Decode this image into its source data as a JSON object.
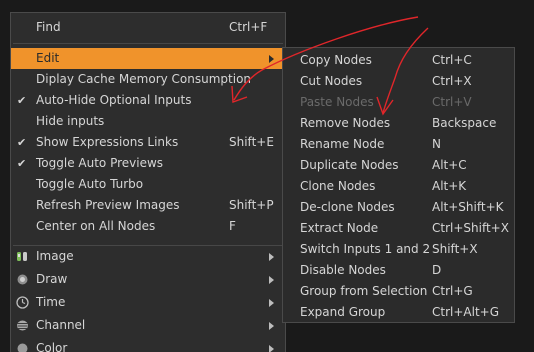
{
  "main_menu": {
    "find": {
      "label": "Find",
      "shortcut": "Ctrl+F"
    },
    "edit": {
      "label": "Edit"
    },
    "items": [
      {
        "label": "Diplay Cache Memory Consumption",
        "shortcut": "",
        "checked": false
      },
      {
        "label": "Auto-Hide Optional Inputs",
        "shortcut": "",
        "checked": true
      },
      {
        "label": "Hide inputs",
        "shortcut": "",
        "checked": false
      },
      {
        "label": "Show Expressions Links",
        "shortcut": "Shift+E",
        "checked": true
      },
      {
        "label": "Toggle Auto Previews",
        "shortcut": "",
        "checked": true
      },
      {
        "label": "Toggle Auto Turbo",
        "shortcut": "",
        "checked": false
      },
      {
        "label": "Refresh Preview Images",
        "shortcut": "Shift+P",
        "checked": false
      },
      {
        "label": "Center on All Nodes",
        "shortcut": "F",
        "checked": false
      }
    ],
    "check_glyph": "✔",
    "categories": [
      {
        "label": "Image",
        "icon": "image-icon"
      },
      {
        "label": "Draw",
        "icon": "draw-icon"
      },
      {
        "label": "Time",
        "icon": "time-icon"
      },
      {
        "label": "Channel",
        "icon": "channel-icon"
      },
      {
        "label": "Color",
        "icon": "color-icon"
      }
    ]
  },
  "edit_submenu": {
    "items": [
      {
        "label": "Copy Nodes",
        "shortcut": "Ctrl+C",
        "disabled": false
      },
      {
        "label": "Cut Nodes",
        "shortcut": "Ctrl+X",
        "disabled": false
      },
      {
        "label": "Paste Nodes",
        "shortcut": "Ctrl+V",
        "disabled": true
      },
      {
        "label": "Remove Nodes",
        "shortcut": "Backspace",
        "disabled": false
      },
      {
        "label": "Rename Node",
        "shortcut": "N",
        "disabled": false
      },
      {
        "label": "Duplicate Nodes",
        "shortcut": "Alt+C",
        "disabled": false
      },
      {
        "label": "Clone Nodes",
        "shortcut": "Alt+K",
        "disabled": false
      },
      {
        "label": "De-clone Nodes",
        "shortcut": "Alt+Shift+K",
        "disabled": false
      },
      {
        "label": "Extract Node",
        "shortcut": "Ctrl+Shift+X",
        "disabled": false
      },
      {
        "label": "Switch Inputs 1 and 2",
        "shortcut": "Shift+X",
        "disabled": false
      },
      {
        "label": "Disable Nodes",
        "shortcut": "D",
        "disabled": false
      },
      {
        "label": "Group from Selection",
        "shortcut": "Ctrl+G",
        "disabled": false
      },
      {
        "label": "Expand Group",
        "shortcut": "Ctrl+Alt+G",
        "disabled": false
      }
    ]
  },
  "colors": {
    "menu_bg": "#2d2d2d",
    "highlight": "#f0932b",
    "text": "#d6d6d6",
    "disabled_text": "#6a6a6a",
    "annotation": "#e0262a"
  }
}
